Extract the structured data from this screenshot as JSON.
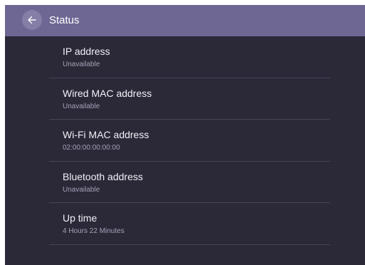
{
  "header": {
    "title": "Status",
    "back_icon": "arrow-left-icon"
  },
  "items": [
    {
      "label": "IP address",
      "value": "Unavailable"
    },
    {
      "label": "Wired MAC address",
      "value": "Unavailable"
    },
    {
      "label": "Wi-Fi MAC address",
      "value": "02:00:00:00:00:00"
    },
    {
      "label": "Bluetooth address",
      "value": "Unavailable"
    },
    {
      "label": "Up time",
      "value": "4 Hours 22 Minutes"
    }
  ],
  "colors": {
    "background": "#2b2838",
    "app_bar": "#6e6793",
    "back_button": "#857ea7",
    "divider": "#47445a"
  }
}
